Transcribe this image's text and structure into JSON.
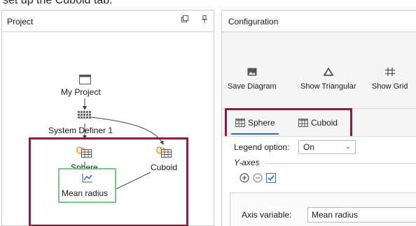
{
  "caption": "set up the Cuboid tab:",
  "project": {
    "title": "Project",
    "nodes": {
      "my_project": "My Project",
      "system_definer": "System Definer 1",
      "sphere": "Sphere",
      "cuboid": "Cuboid",
      "mean_radius": "Mean radius"
    }
  },
  "config": {
    "title": "Configuration",
    "toolbar": {
      "save_diagram": "Save Diagram",
      "show_triangular": "Show Triangular",
      "show_grid": "Show Grid"
    },
    "tabs": [
      "Sphere",
      "Cuboid"
    ],
    "legend_option_label": "Legend option:",
    "legend_option_value": "On",
    "y_axes_label": "Y-axes",
    "axis_variable_label": "Axis variable:",
    "axis_variable_value": "Mean radius"
  },
  "colors": {
    "highlight": "#8b1d3f",
    "result_border": "#7cc38a",
    "accent": "#2b6cc8"
  }
}
